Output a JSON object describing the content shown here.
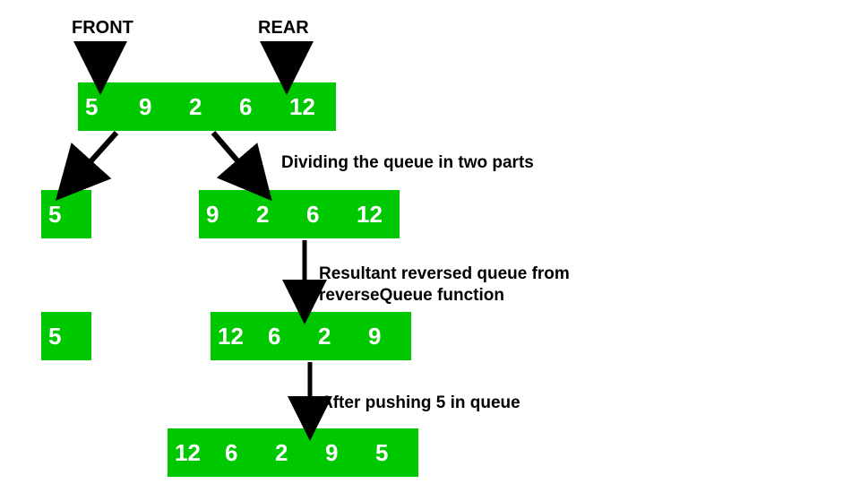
{
  "labels": {
    "front": "FRONT",
    "rear": "REAR"
  },
  "captions": {
    "divide": "Dividing the queue in two parts",
    "reverse_l1": "Resultant reversed queue from",
    "reverse_l2": "reverseQueue function",
    "push": "After pushing 5 in queue"
  },
  "rows": {
    "top": [
      "5",
      "9",
      "2",
      "6",
      "12"
    ],
    "split_l": [
      "5"
    ],
    "split_r": [
      "9",
      "2",
      "6",
      "12"
    ],
    "rev_l": [
      "5"
    ],
    "rev_r": [
      "12",
      "6",
      "2",
      "9"
    ],
    "final": [
      "12",
      "6",
      "2",
      "9",
      "5"
    ]
  },
  "colors": {
    "cell_bg": "#00c800",
    "cell_fg": "#ffffff"
  }
}
